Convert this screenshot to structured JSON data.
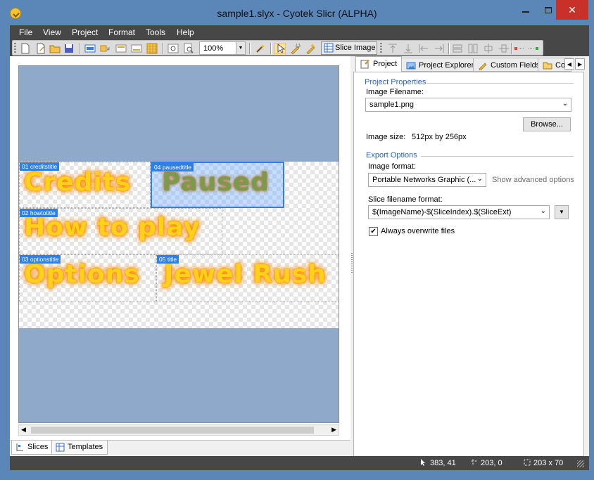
{
  "window": {
    "title": "sample1.slyx - Cyotek Slicr  (ALPHA)"
  },
  "menu": {
    "items": [
      "File",
      "View",
      "Project",
      "Format",
      "Tools",
      "Help"
    ]
  },
  "toolbar": {
    "zoom_value": "100%",
    "slice_image_label": "Slice Image"
  },
  "canvas": {
    "slices": [
      {
        "tag": "01 creditstitle",
        "text": "Credits"
      },
      {
        "tag": "04 pausedtitle",
        "text": "Paused",
        "selected": true
      },
      {
        "tag": "02 howtotitle",
        "text": "How to play"
      },
      {
        "tag": "03 optionstitle",
        "text": "Options"
      },
      {
        "tag": "05 title",
        "text": "Jewel Rush"
      }
    ]
  },
  "bottom_tabs": {
    "slices": "Slices",
    "templates": "Templates"
  },
  "right_tabs": {
    "project": "Project",
    "project_explorer": "Project Explorer",
    "custom_fields": "Custom Fields",
    "co": "Co"
  },
  "properties": {
    "project_properties_title": "Project Properties",
    "image_filename_label": "Image Filename:",
    "image_filename_value": "sample1.png",
    "browse_label": "Browse...",
    "image_size_label": "Image size:",
    "image_size_value": "512px by 256px",
    "export_options_title": "Export Options",
    "image_format_label": "Image format:",
    "image_format_value": "Portable Networks Graphic (...",
    "show_advanced_label": "Show advanced options",
    "slice_filename_label": "Slice filename format:",
    "slice_filename_value": "$(ImageName)-$(SliceIndex).$(SliceExt)",
    "always_overwrite_label": "Always overwrite files",
    "always_overwrite_checked": true
  },
  "status": {
    "cursor": "383, 41",
    "position": "203, 0",
    "size": "203 x 70"
  },
  "colors": {
    "accent": "#2f80e0",
    "chrome": "#474747",
    "titlebar": "#5b87b8",
    "close": "#c7312a"
  }
}
